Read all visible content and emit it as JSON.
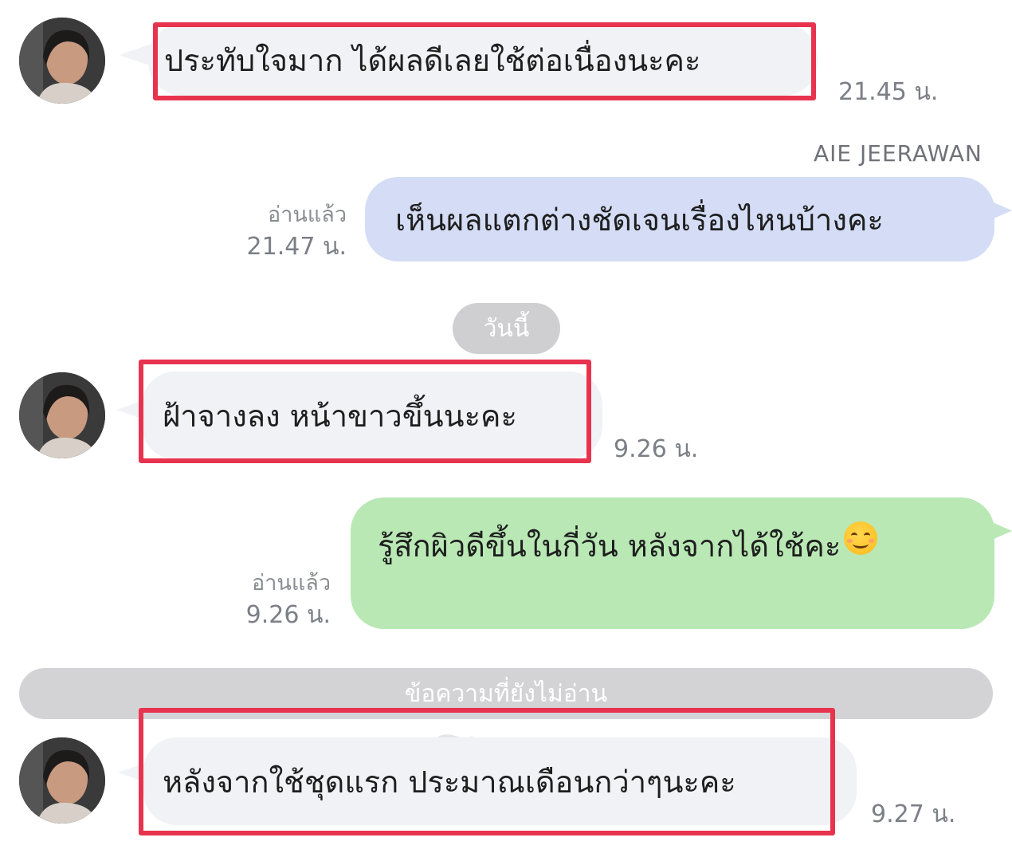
{
  "messages": [
    {
      "id": "m1",
      "side": "in",
      "text": "ประทับใจมาก ได้ผลดีเลยใช้ต่อเนื่องนะคะ",
      "time": "21.45 น."
    },
    {
      "id": "m2",
      "side": "out",
      "sender": "AIE JEERAWAN",
      "text": "เห็นผลแตกต่างชัดเจนเรื่องไหนบ้างคะ",
      "read": "อ่านแล้ว",
      "time": "21.47 น."
    },
    {
      "id": "m3",
      "side": "in",
      "text": "ฝ้าจางลง  หน้าขาวขึ้นนะคะ",
      "time": "9.26 น."
    },
    {
      "id": "m4",
      "side": "out",
      "text": "รู้สึกผิวดีขึ้นในกี่วัน หลังจากได้ใช้คะ",
      "emoji": "smiling-face-emoji",
      "read": "อ่านแล้ว",
      "time": "9.26 น."
    },
    {
      "id": "m5",
      "side": "in",
      "text": "หลังจากใช้ชุดแรก ประมาณเดือนกว่าๆนะคะ",
      "time": "9.27 น."
    }
  ],
  "date_divider": "วันนี้",
  "unread_divider": "ข้อความที่ยังไม่อ่าน",
  "colors": {
    "highlight": "#e8334f",
    "bubble_in": "#f1f2f6",
    "bubble_out_blue": "#d4ddf5",
    "bubble_out_green": "#b9e8b5"
  }
}
